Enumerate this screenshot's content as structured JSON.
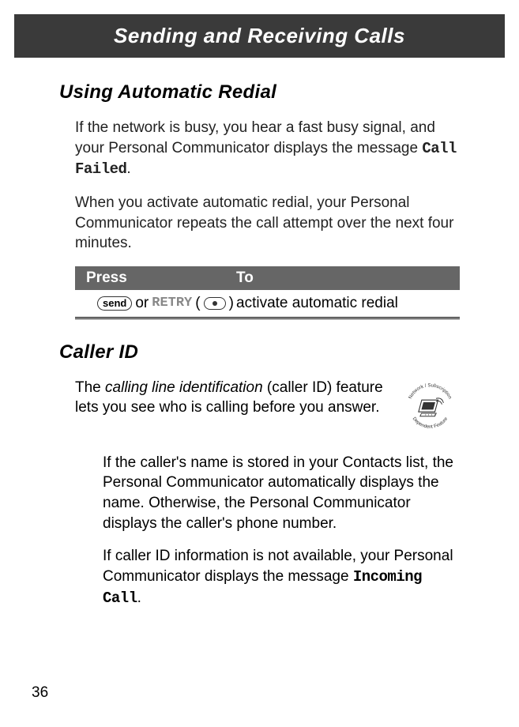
{
  "header": {
    "title": "Sending and Receiving Calls"
  },
  "section1": {
    "heading": "Using Automatic Redial",
    "para1_prefix": "If the network is busy, you hear a fast busy signal, and your Personal Communicator displays the message ",
    "para1_mono": "Call Failed",
    "para1_suffix": ".",
    "para2": "When you activate automatic redial, your Personal Communicator repeats the call attempt over the next four minutes."
  },
  "table": {
    "header": {
      "col1": "Press",
      "col2": "To"
    },
    "row": {
      "send_label": "send",
      "or_text": " or ",
      "retry_label": "RETRY",
      "paren_open": " (",
      "paren_close": ")",
      "action": "activate automatic redial"
    }
  },
  "section2": {
    "heading": "Caller ID",
    "intro_prefix": "The ",
    "intro_italic": "calling line identification",
    "intro_suffix": " (caller ID) feature lets you see who is calling before you answer.",
    "badge_top": "Network / Subscription",
    "badge_bottom": "Dependent Feature",
    "para2": "If the caller's name is stored in your Contacts list, the Personal Communicator automatically displays the name. Otherwise, the Personal Communicator displays the caller's phone number.",
    "para3_prefix": "If caller ID information is not available, your Personal Communicator displays the message ",
    "para3_mono": "Incoming Call",
    "para3_suffix": "."
  },
  "page_number": "36"
}
